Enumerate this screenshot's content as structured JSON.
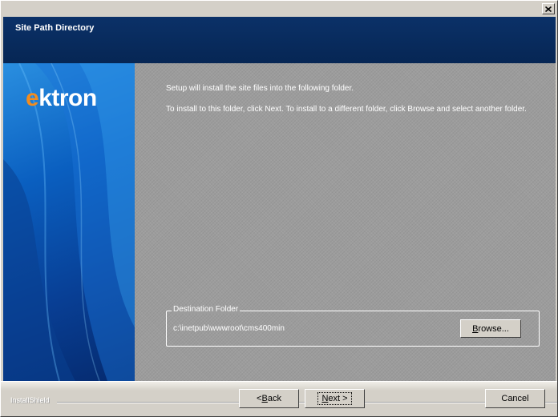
{
  "header": {
    "title": "Site Path Directory"
  },
  "logo": {
    "text_first": "e",
    "text_rest": "ktron"
  },
  "content": {
    "message_1": "Setup will install the site files into the following folder.",
    "message_2": "To install to this folder, click Next. To install to a different folder, click Browse and select another folder.",
    "destination": {
      "legend": "Destination Folder",
      "path": "c:\\inetpub\\wwwroot\\cms400min",
      "browse_accel": "B",
      "browse_rest": "rowse..."
    }
  },
  "footer": {
    "brand": "InstallShield",
    "back_prefix": "< ",
    "back_accel": "B",
    "back_rest": "ack",
    "next_accel": "N",
    "next_rest": "ext >",
    "cancel_label": "Cancel"
  },
  "colors": {
    "header_bg": "#0b3168",
    "logo_accent": "#f28c1e",
    "content_bg": "#9c9c9c",
    "chrome": "#d4d0c8"
  },
  "icons": {
    "close": "close-x-icon"
  }
}
